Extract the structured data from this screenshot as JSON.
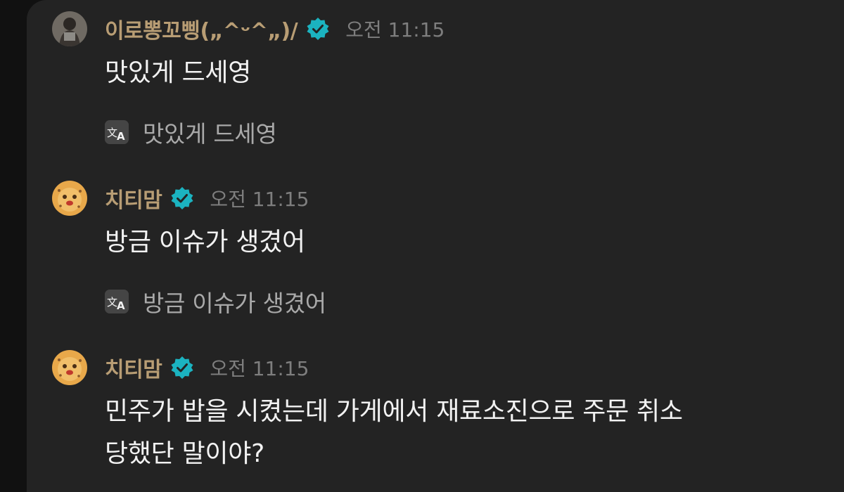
{
  "colors": {
    "background": "#232323",
    "username": "#b89d74",
    "verified_badge": "#1bb3c0",
    "timestamp": "#7e7e7e",
    "message_text": "#f2f2f2",
    "translation_text": "#a9a9a9"
  },
  "messages": [
    {
      "username": "이로뽕꼬삥(„^ᵕ^„)/",
      "verified": true,
      "timestamp": "오전 11:15",
      "text_lines": [
        "맛있게 드세영"
      ],
      "translation": "맛있게 드세영",
      "translation_icon": "translate-icon"
    },
    {
      "username": "치티맘",
      "verified": true,
      "timestamp": "오전 11:15",
      "text_lines": [
        "방금 이슈가 생겼어"
      ],
      "translation": "방금 이슈가 생겼어",
      "translation_icon": "translate-icon"
    },
    {
      "username": "치티맘",
      "verified": true,
      "timestamp": "오전 11:15",
      "text_lines": [
        "민주가 밥을 시켰는데 가게에서 재료소진으로 주문 취소",
        "당했단 말이야?"
      ]
    }
  ]
}
